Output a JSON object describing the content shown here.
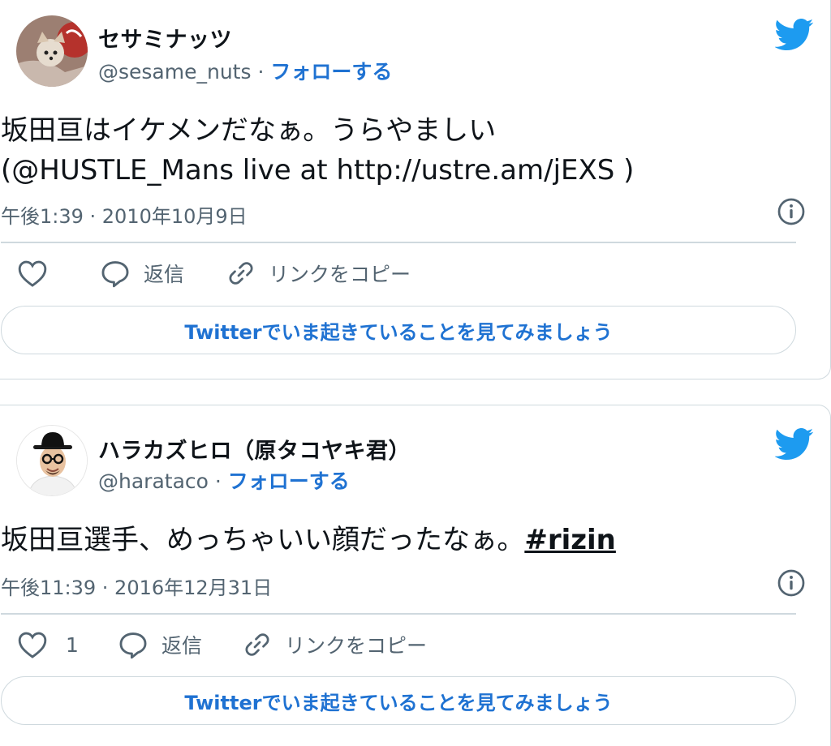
{
  "tweets": [
    {
      "display_name": "セサミナッツ",
      "handle": "@sesame_nuts",
      "follow_label": "フォローする",
      "text_line1": "坂田亘はイケメンだなぁ。うらやましい",
      "text_line2": "(@HUSTLE_Mans live at http://ustre.am/jEXS )",
      "timestamp": "午後1:39 · 2010年10月9日",
      "like_count": "",
      "reply_label": "返信",
      "copy_link_label": "リンクをコピー",
      "cta_label": "Twitterでいま起きていることを見てみましょう"
    },
    {
      "display_name": "ハラカズヒロ（原タコヤキ君）",
      "handle": "@harataco",
      "follow_label": "フォローする",
      "text_main": "坂田亘選手、めっちゃいい顔だったなぁ。",
      "hashtag": "#rizin",
      "timestamp": "午後11:39 · 2016年12月31日",
      "like_count": "1",
      "reply_label": "返信",
      "copy_link_label": "リンクをコピー",
      "cta_label": "Twitterでいま起きていることを見てみましょう"
    }
  ],
  "separator": " · ",
  "colors": {
    "accent": "#1d9bf0",
    "link": "#1f72d2",
    "text": "#0f1419",
    "muted": "#536471",
    "border": "#cfd9de"
  },
  "icons": [
    "twitter-bird-icon",
    "info-icon",
    "heart-icon",
    "reply-bubble-icon",
    "link-icon"
  ]
}
